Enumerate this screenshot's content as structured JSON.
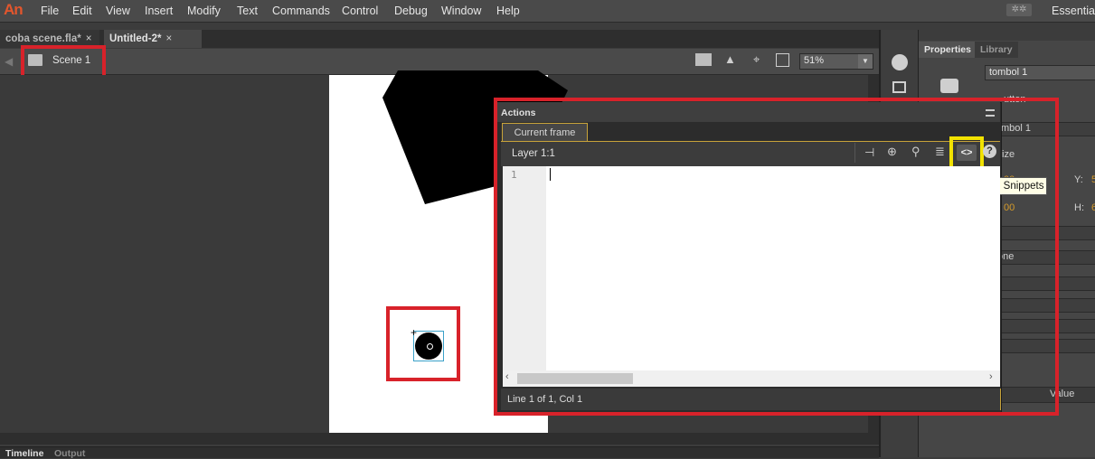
{
  "app": {
    "logo": "An",
    "workspace": "Essentia"
  },
  "menu": [
    "File",
    "Edit",
    "View",
    "Insert",
    "Modify",
    "Text",
    "Commands",
    "Control",
    "Debug",
    "Window",
    "Help"
  ],
  "doc_tabs": [
    {
      "label": "coba scene.fla*",
      "close": "×"
    },
    {
      "label": "Untitled-2*",
      "close": "×"
    }
  ],
  "editbar": {
    "scene": "Scene 1",
    "zoom": "51%"
  },
  "bottom_tabs": [
    "Timeline",
    "Output"
  ],
  "properties": {
    "tabs": [
      "Properties",
      "Library"
    ],
    "instance_name": "tombol 1",
    "fragments": [
      "utton",
      "mbol 1",
      "ize",
      "Y:",
      "H:",
      "one",
      "Value",
      "5",
      "6",
      "00",
      "00"
    ]
  },
  "actions": {
    "title": "Actions",
    "tab": "Current frame",
    "layer": "Layer 1:1",
    "line_number": "1",
    "status": "Line 1 of 1, Col 1",
    "tooltip": "Code Snippets",
    "snippet_icon": "<>",
    "help_icon": "?"
  },
  "colors": {
    "highlight_red": "#d8222a",
    "highlight_yellow": "#f2e200",
    "logo": "#e2562d"
  }
}
